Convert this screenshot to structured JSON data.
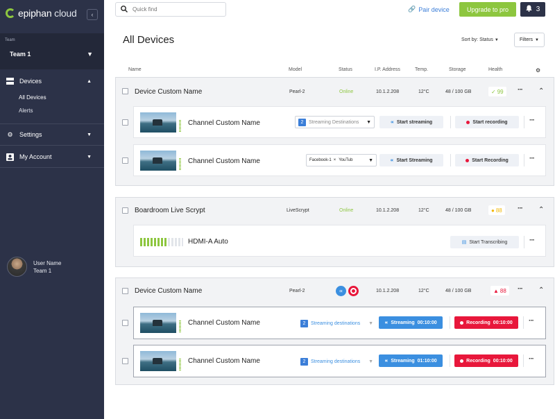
{
  "app": {
    "brand": "epiphan",
    "brand_suffix": "cloud",
    "collapse_icon": "chevron-left-icon"
  },
  "sidebar": {
    "team_label": "Team",
    "team_value": "Team 1",
    "nav": {
      "devices": "Devices",
      "all_devices": "All Devices",
      "alerts": "Alerts",
      "settings": "Settings",
      "my_account": "My Account"
    },
    "user": {
      "name": "User Name",
      "team": "Team 1"
    }
  },
  "topbar": {
    "search_placeholder": "Quick find",
    "pair_device": "Pair device",
    "upgrade": "Upgrade to pro",
    "notification_count": "3"
  },
  "main": {
    "title": "All Devices",
    "sort_label": "Sort by: Status",
    "filters_label": "Filters",
    "columns": [
      "Name",
      "Model",
      "Status",
      "I.P. Address",
      "Temp.",
      "Storage",
      "Health"
    ]
  },
  "devices": [
    {
      "name": "Device Custom Name",
      "model": "Pearl-2",
      "status": "Online",
      "ip": "10.1.2.208",
      "temp": "12°C",
      "storage": "48 / 100 GB",
      "health": "99",
      "channels": [
        {
          "name": "Channel Custom Name",
          "dest_count": "2",
          "dest_label": "Streaming Destinations",
          "stream_btn": "Start streaming",
          "record_btn": "Start recording"
        },
        {
          "name": "Channel Custom Name",
          "tags": [
            "Facebook-1",
            "YouTub"
          ],
          "stream_btn": "Start Streaming",
          "record_btn": "Start Recording"
        }
      ]
    },
    {
      "name": "Boardroom Live Scrypt",
      "model": "LiveScrypt",
      "status": "Online",
      "ip": "10.1.2.208",
      "temp": "12°C",
      "storage": "48 / 100 GB",
      "health": "88",
      "channels": [
        {
          "name": "HDMI-A Auto",
          "action_btn": "Start Transcribing"
        }
      ]
    },
    {
      "name": "Device Custom Name",
      "model": "Pearl-2",
      "ip": "10.1.2.208",
      "temp": "12°C",
      "storage": "48 / 100 GB",
      "health": "88",
      "channels": [
        {
          "name": "Channel Custom Name",
          "dest_count": "2",
          "dest_label": "Streaming destinations",
          "stream_btn": "Streaming",
          "stream_time": "00:10:00",
          "record_btn": "Recording",
          "record_time": "00:10:00"
        },
        {
          "name": "Channel Custom Name",
          "dest_count": "2",
          "dest_label": "Streaming destinations",
          "stream_btn": "Streaming",
          "stream_time": "01:10:00",
          "record_btn": "Recording",
          "record_time": "00:10:00"
        }
      ]
    }
  ],
  "colors": {
    "sidebar": "#2c3248",
    "accent_green": "#8dc63f",
    "blue": "#3b8fe0",
    "red": "#e8173b",
    "warn_yellow": "#f2b705"
  }
}
